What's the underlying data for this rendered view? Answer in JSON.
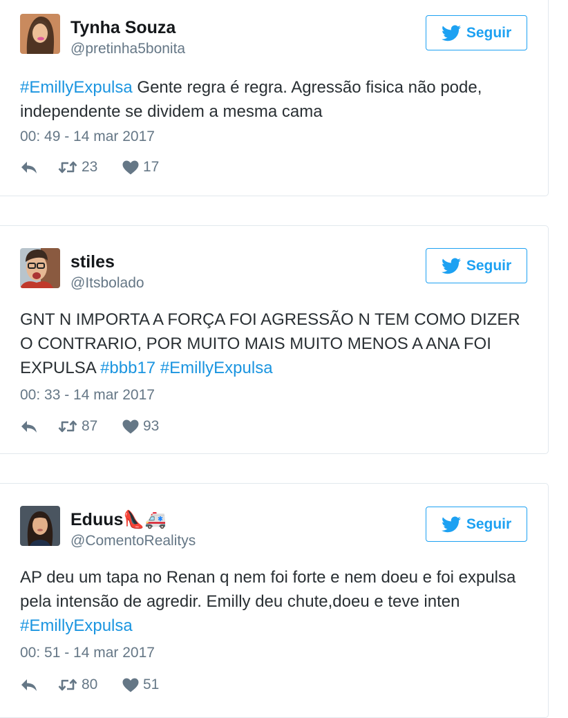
{
  "follow_label": "Seguir",
  "colors": {
    "link": "#1b95e0",
    "accent": "#1da1f2",
    "meta": "#657786"
  },
  "tweets": [
    {
      "name": "Tynha Souza",
      "handle": "@pretinha5bonita",
      "text": [
        {
          "t": "#EmillyExpulsa",
          "tag": true
        },
        {
          "t": " Gente regra é regra. Agressão fisica não pode, independente se dividem a mesma cama",
          "tag": false
        }
      ],
      "timestamp": "00: 49 - 14 mar 2017",
      "retweets": "23",
      "likes": "17",
      "avatar_icon": "avatar-photo"
    },
    {
      "name": "stiles",
      "handle": "@Itsbolado",
      "text": [
        {
          "t": "GNT N IMPORTA A FORÇA FOI AGRESSÃO N TEM COMO DIZER O CONTRARIO, POR MUITO MAIS MUITO MENOS A ANA FOI EXPULSA ",
          "tag": false
        },
        {
          "t": "#bbb17",
          "tag": true
        },
        {
          "t": " ",
          "tag": false
        },
        {
          "t": "#EmillyExpulsa",
          "tag": true
        }
      ],
      "timestamp": "00: 33 - 14 mar 2017",
      "retweets": "87",
      "likes": "93",
      "avatar_icon": "avatar-photo"
    },
    {
      "name": "Eduus👠🚑",
      "handle": "@ComentoRealitys",
      "text": [
        {
          "t": "AP deu um tapa no Renan q nem foi forte e nem doeu e foi expulsa pela intensão de agredir. Emilly deu chute,doeu e teve inten ",
          "tag": false
        },
        {
          "t": "#EmillyExpulsa",
          "tag": true
        }
      ],
      "timestamp": "00: 51 - 14 mar 2017",
      "retweets": "80",
      "likes": "51",
      "avatar_icon": "avatar-photo"
    }
  ]
}
